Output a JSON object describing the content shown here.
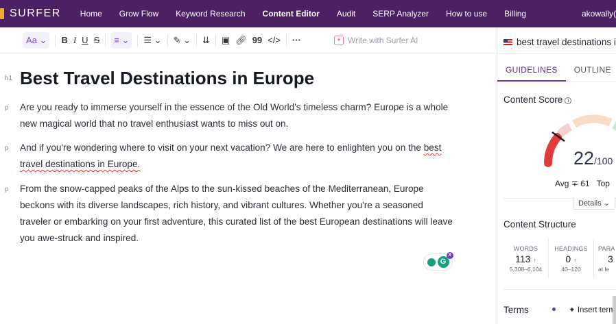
{
  "nav": {
    "brand": "SURFER",
    "items": [
      "Home",
      "Grow Flow",
      "Keyword Research",
      "Content Editor",
      "Audit",
      "SERP Analyzer",
      "How to use",
      "Billing"
    ],
    "active": "Content Editor",
    "user": "akowally("
  },
  "toolbar": {
    "font": "Aa",
    "bold": "B",
    "italic": "I",
    "underline": "U",
    "strike": "S",
    "quote": "99",
    "code": "</>",
    "more": "···",
    "ai": "Write with Surfer AI"
  },
  "editor": {
    "h1_tag": "h1",
    "p_tag": "p",
    "title": "Best Travel Destinations in Europe",
    "p1": "Are you ready to immerse yourself in the essence of the Old World's timeless charm? Europe is a whole new magical world that no travel enthusiast wants to miss out on.",
    "p2_pre": "And if you're wondering where to visit on your next vacation? We are here to enlighten you on the ",
    "p2_link": "best travel destinations in Europe.",
    "p3": "From the snow-capped peaks of the Alps to the sun-kissed beaches of the Mediterranean, Europe beckons with its diverse landscapes, rich history, and vibrant cultures. Whether you're a seasoned traveler or embarking on your first adventure, this curated list of the best European destinations will leave you awe-struck and inspired.",
    "grammarly_count": "3"
  },
  "panel": {
    "keyword": "best travel destinations i",
    "tabs": [
      "GUIDELINES",
      "OUTLINE"
    ],
    "content_score_label": "Content Score",
    "score": "22",
    "score_max": "/100",
    "avg_label": "Avg",
    "avg": "61",
    "top_label": "Top",
    "details": "Details",
    "structure_label": "Content Structure",
    "stats": [
      {
        "label": "WORDS",
        "value": "113",
        "range": "5,308–6,104"
      },
      {
        "label": "HEADINGS",
        "value": "0",
        "range": "40–120"
      },
      {
        "label": "PARA",
        "value": "3",
        "range": "at le"
      }
    ],
    "terms_label": "Terms",
    "insert_terms": "Insert term"
  },
  "colors": {
    "nav": "#4b2163",
    "accent": "#6a3a9a",
    "score_red": "#e03c3c"
  }
}
